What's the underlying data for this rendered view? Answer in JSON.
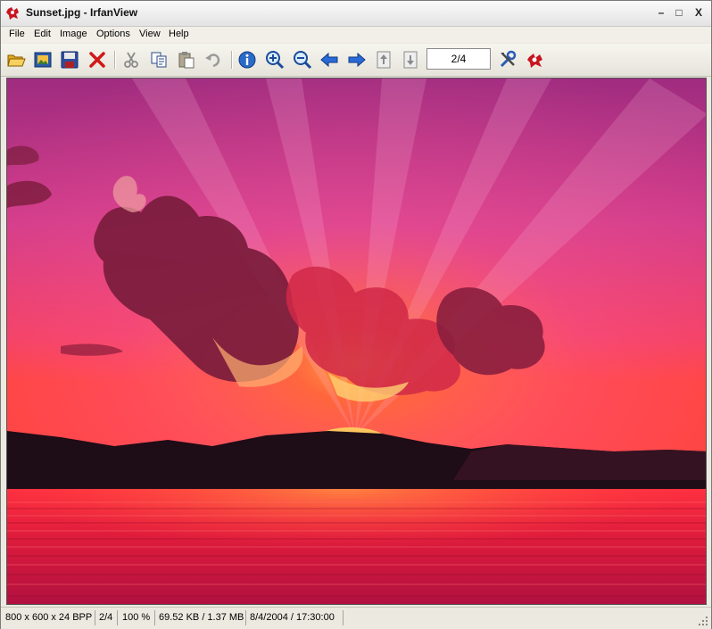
{
  "window": {
    "title": "Sunset.jpg - IrfanView",
    "minimize_label": "–",
    "maximize_label": "□",
    "close_label": "X"
  },
  "menu": {
    "items": [
      "File",
      "Edit",
      "Image",
      "Options",
      "View",
      "Help"
    ]
  },
  "toolbar": {
    "page_indicator": "2/4",
    "icons": [
      "open-folder-icon",
      "slideshow-icon",
      "save-icon",
      "delete-icon",
      "cut-icon",
      "copy-icon",
      "paste-icon",
      "undo-icon",
      "info-icon",
      "zoom-in-icon",
      "zoom-out-icon",
      "previous-icon",
      "next-icon",
      "first-page-icon",
      "last-page-icon",
      "settings-icon",
      "irfanview-logo-icon"
    ]
  },
  "status": {
    "dimensions": "800 x 600 x 24 BPP",
    "page": "2/4",
    "zoom": "100 %",
    "filesize": "69.52 KB / 1.37 MB",
    "datetime": "8/4/2004 / 17:30:00"
  },
  "colors": {
    "sky_top": "#a8307a",
    "sky_mid": "#e24a8a",
    "sun_glow": "#ff7a20",
    "horizon": "#ff3a3a",
    "water": "#e8203a",
    "mountains": "#1e0e18"
  }
}
